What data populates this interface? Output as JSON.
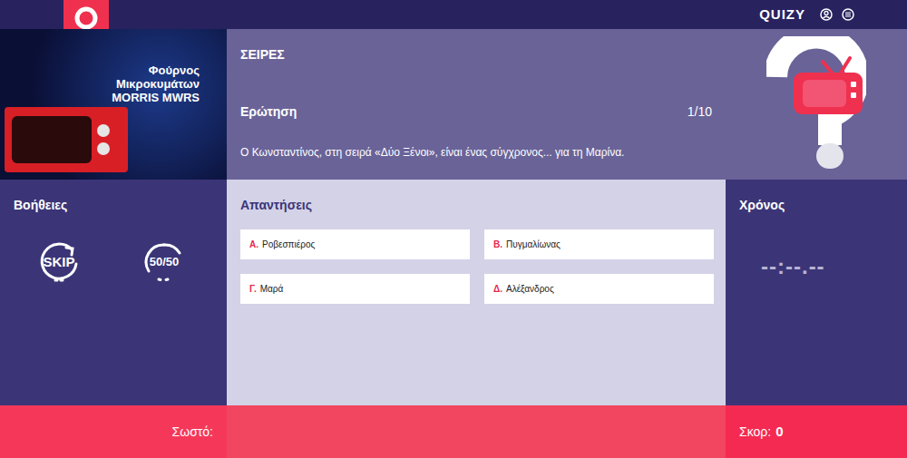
{
  "header": {
    "logo": "QUIZY"
  },
  "ad": {
    "lines": [
      "Φούρνος",
      "Μικροκυμάτων",
      "MORRIS MWRS"
    ]
  },
  "category": "ΣΕΙΡΕΣ",
  "question": {
    "label": "Ερώτηση",
    "counter": "1/10",
    "text": "Ο Κωνσταντίνος, στη σειρά «Δύο Ξένοι», είναι ένας σύγχρονος... για τη Μαρίνα."
  },
  "helps": {
    "title": "Βοήθειες",
    "items": [
      {
        "label": "SKIP",
        "kind": "skip"
      },
      {
        "label": "50/50",
        "kind": "fifty"
      }
    ]
  },
  "answers": {
    "title": "Απαντήσεις",
    "items": [
      {
        "letter": "Α.",
        "text": "Ροβεσπιέρος",
        "selected": false
      },
      {
        "letter": "Β.",
        "text": "Πυγμαλίωνας",
        "selected": false
      },
      {
        "letter": "Γ.",
        "text": "Μαρά",
        "selected": false
      },
      {
        "letter": "Δ.",
        "text": "Αλέξανδρος",
        "selected": false
      }
    ]
  },
  "timer": {
    "title": "Χρόνος",
    "value": "--:--.--"
  },
  "footer": {
    "correct_label": "Σωστό:",
    "score_label": "Σκορ:",
    "score": "0"
  }
}
